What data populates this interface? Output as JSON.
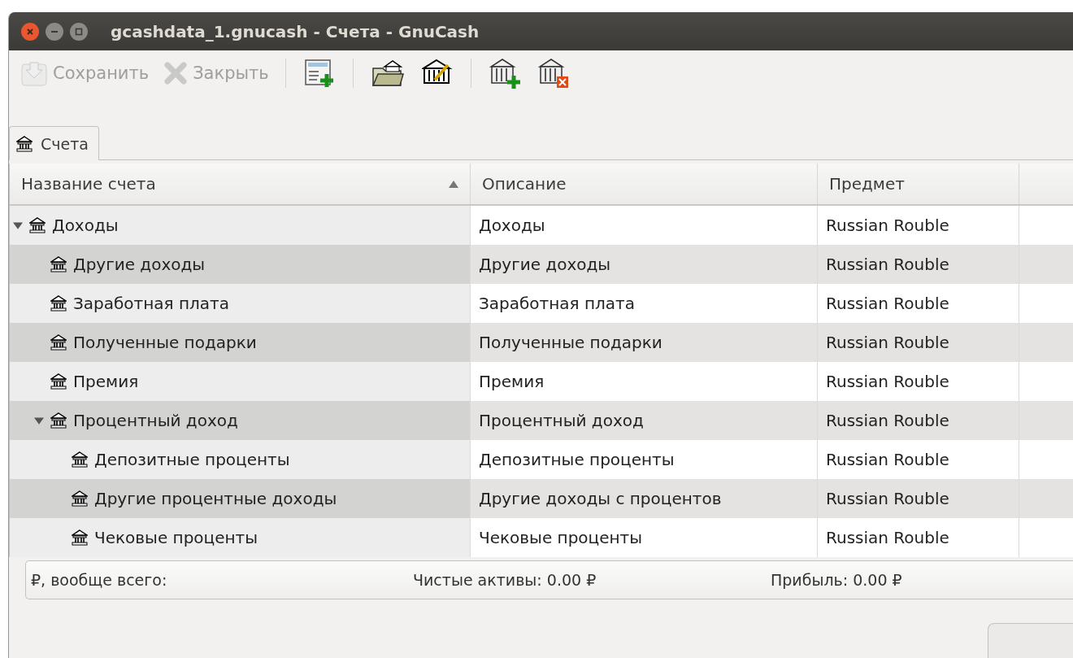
{
  "window": {
    "title": "gcashdata_1.gnucash - Счета - GnuCash"
  },
  "toolbar": {
    "buttons": [
      {
        "label": "Сохранить",
        "disabled": true
      },
      {
        "label": "Закрыть",
        "disabled": true
      }
    ]
  },
  "tabs": [
    {
      "label": "Счета",
      "selected": true
    }
  ],
  "table": {
    "columns": [
      {
        "label": "Название счета",
        "sorted": true
      },
      {
        "label": "Описание",
        "sorted": false
      },
      {
        "label": "Предмет",
        "sorted": false
      }
    ],
    "rows": [
      {
        "name": "Доходы",
        "description": "Доходы",
        "commodity": "Russian Rouble",
        "expanded": true,
        "children": [
          {
            "name": "Другие доходы",
            "description": "Другие доходы",
            "commodity": "Russian Rouble"
          },
          {
            "name": "Заработная плата",
            "description": "Заработная плата",
            "commodity": "Russian Rouble"
          },
          {
            "name": "Полученные подарки",
            "description": "Полученные подарки",
            "commodity": "Russian Rouble"
          },
          {
            "name": "Премия",
            "description": "Премия",
            "commodity": "Russian Rouble"
          },
          {
            "name": "Процентный доход",
            "description": "Процентный доход",
            "commodity": "Russian Rouble",
            "expanded": true,
            "children": [
              {
                "name": "Депозитные проценты",
                "description": "Депозитные проценты",
                "commodity": "Russian Rouble"
              },
              {
                "name": "Другие процентные доходы",
                "description": "Другие доходы с процентов",
                "commodity": "Russian Rouble"
              },
              {
                "name": "Чековые проценты",
                "description": "Чековые проценты",
                "commodity": "Russian Rouble"
              }
            ]
          }
        ]
      }
    ]
  },
  "summary": {
    "label": "₽, вообще всего:",
    "net_assets": "Чистые активы: 0.00 ₽",
    "profit": "Прибыль: 0.00 ₽"
  }
}
